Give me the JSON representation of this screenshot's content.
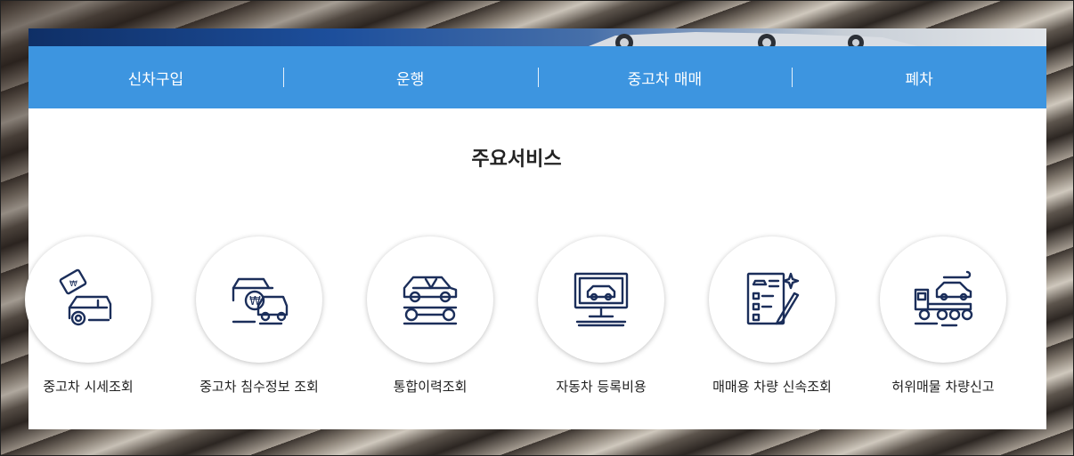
{
  "tabs": [
    {
      "label": "신차구입"
    },
    {
      "label": "운행"
    },
    {
      "label": "중고차 매매"
    },
    {
      "label": "폐차"
    }
  ],
  "section_title": "주요서비스",
  "services": [
    {
      "label": "중고차 시세조회",
      "icon": "price-tag-car-icon"
    },
    {
      "label": "중고차 침수정보 조회",
      "icon": "flooded-cars-icon"
    },
    {
      "label": "통합이력조회",
      "icon": "car-repair-wrench-icon"
    },
    {
      "label": "자동차 등록비용",
      "icon": "car-monitor-icon"
    },
    {
      "label": "매매용 차량 신속조회",
      "icon": "document-pen-icon"
    },
    {
      "label": "허위매물 차량신고",
      "icon": "tow-truck-icon"
    }
  ],
  "colors": {
    "nav": "#3d95e0",
    "icon": "#1b2e5a"
  }
}
